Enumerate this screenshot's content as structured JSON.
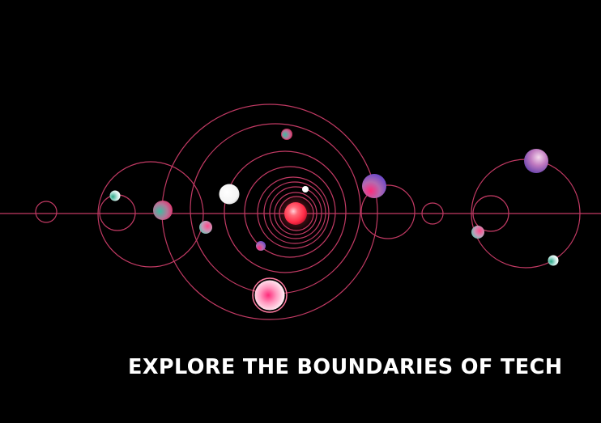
{
  "hero": {
    "tagline": "EXPLORE THE BOUNDARIES OF TECH"
  },
  "colors": {
    "background": "#000000",
    "orbit_line": "#c23a64",
    "text": "#ffffff",
    "sun_core": "#ff3d55",
    "planet_pink": "#ff2a7a",
    "planet_teal": "#3dbca0",
    "planet_purple": "#7a48c8"
  }
}
